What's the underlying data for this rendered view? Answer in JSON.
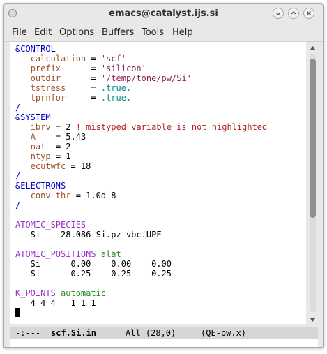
{
  "window": {
    "title": "emacs@catalyst.ijs.si"
  },
  "colors": {
    "section": "#0000cd",
    "variable": "#a0522d",
    "string": "#8b2252",
    "boolean": "#008b8b",
    "card": "#9a32cd",
    "card_option": "#228b22",
    "error": "#b22222"
  },
  "menubar": {
    "items": [
      "File",
      "Edit",
      "Options",
      "Buffers",
      "Tools",
      "Help"
    ]
  },
  "editor": {
    "lines": {
      "l1": "&CONTROL",
      "l2_var": "calculation",
      "l2_eq": " = ",
      "l2_val": "'scf'",
      "l3_var": "prefix",
      "l3_eq": "      = ",
      "l3_val": "'silicon'",
      "l4_var": "outdir",
      "l4_eq": "      = ",
      "l4_val": "'/temp/tone/pw/Si'",
      "l5_var": "tstress",
      "l5_eq": "     = ",
      "l5_val": ".true.",
      "l6_var": "tprnfor",
      "l6_eq": "     = ",
      "l6_val": ".true.",
      "l7": "/",
      "l8": "&SYSTEM",
      "l9_var": "ibrv",
      "l9_eq": " = 2 ",
      "l9_err": "! mistyped variable is not highlighted",
      "l10_var": "A",
      "l10_eq": "    = 5.43",
      "l11_var": "nat",
      "l11_eq": "  = 2",
      "l12_var": "ntyp",
      "l12_eq": " = 1",
      "l13_var": "ecutwfc",
      "l13_eq": " = 18",
      "l14": "/",
      "l15": "&ELECTRONS",
      "l16_var": "conv_thr",
      "l16_eq": " = 1.0d-8",
      "l17": "/",
      "l19": "ATOMIC_SPECIES",
      "l20": "   Si    28.086 Si.pz-vbc.UPF",
      "l22_card": "ATOMIC_POSITIONS",
      "l22_opt": " alat",
      "l23": "   Si      0.00    0.00    0.00",
      "l24": "   Si      0.25    0.25    0.25",
      "l26_card": "K_POINTS",
      "l26_opt": " automatic",
      "l27": "   4 4 4   1 1 1"
    }
  },
  "modeline": {
    "status": "-:---",
    "buffer_name": "scf.Si.in",
    "position": "All (28,0)",
    "mode": "(QE-pw.x)"
  },
  "scrollbar": {
    "visible_fraction": 0.62
  }
}
